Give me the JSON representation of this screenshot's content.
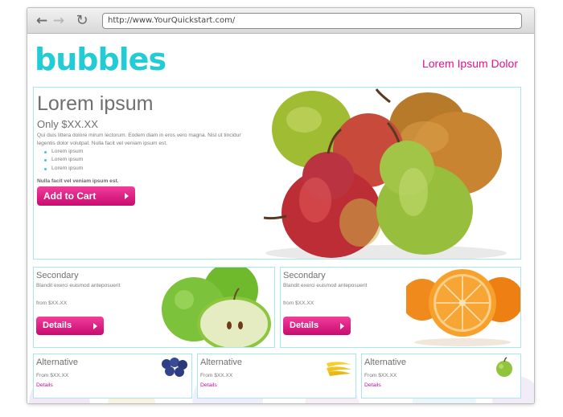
{
  "browser": {
    "url": "http://www.YourQuickstart.com/",
    "nav": {
      "back_icon": "←",
      "forward_icon": "→",
      "reload_icon": "↻"
    }
  },
  "header": {
    "logo": "bubbles",
    "tagline": "Lorem Ipsum Dolor"
  },
  "hero": {
    "title": "Lorem ipsum",
    "price": "Only $XX.XX",
    "description": "Qui duis littera dolore mirum lectorum. Eodem diam in eros vero magna. Nisl ut tincidunt legentis dolor volutpat. Nulla facit vel veniam ipsum est.",
    "bullets": [
      "Lorem ipsum",
      "Lorem ipsum",
      "Lorem ipsum"
    ],
    "note": "Nulla facit vel veniam ipsum est.",
    "button": "Add to Cart",
    "image": "pears-image"
  },
  "secondary": [
    {
      "title": "Secondary",
      "subtitle": "Blandit exerci euismod anteposuerit",
      "price": "from $XX.XX",
      "button": "Details",
      "image": "green-apples-image"
    },
    {
      "title": "Secondary",
      "subtitle": "Blandit exerci euismod anteposuerit",
      "price": "from $XX.XX",
      "button": "Details",
      "image": "oranges-image"
    }
  ],
  "alternative": [
    {
      "title": "Alternative",
      "price": "From $XX.XX",
      "link": "Details",
      "image": "blueberries-thumb"
    },
    {
      "title": "Alternative",
      "price": "From $XX.XX",
      "link": "Details",
      "image": "bananas-thumb"
    },
    {
      "title": "Alternative",
      "price": "From $XX.XX",
      "link": "Details",
      "image": "apple-thumb"
    }
  ],
  "colors": {
    "accent_teal": "#22ccd4",
    "accent_pink": "#e0138a",
    "panel_border": "#a9e6ec",
    "link": "#b414a0"
  }
}
